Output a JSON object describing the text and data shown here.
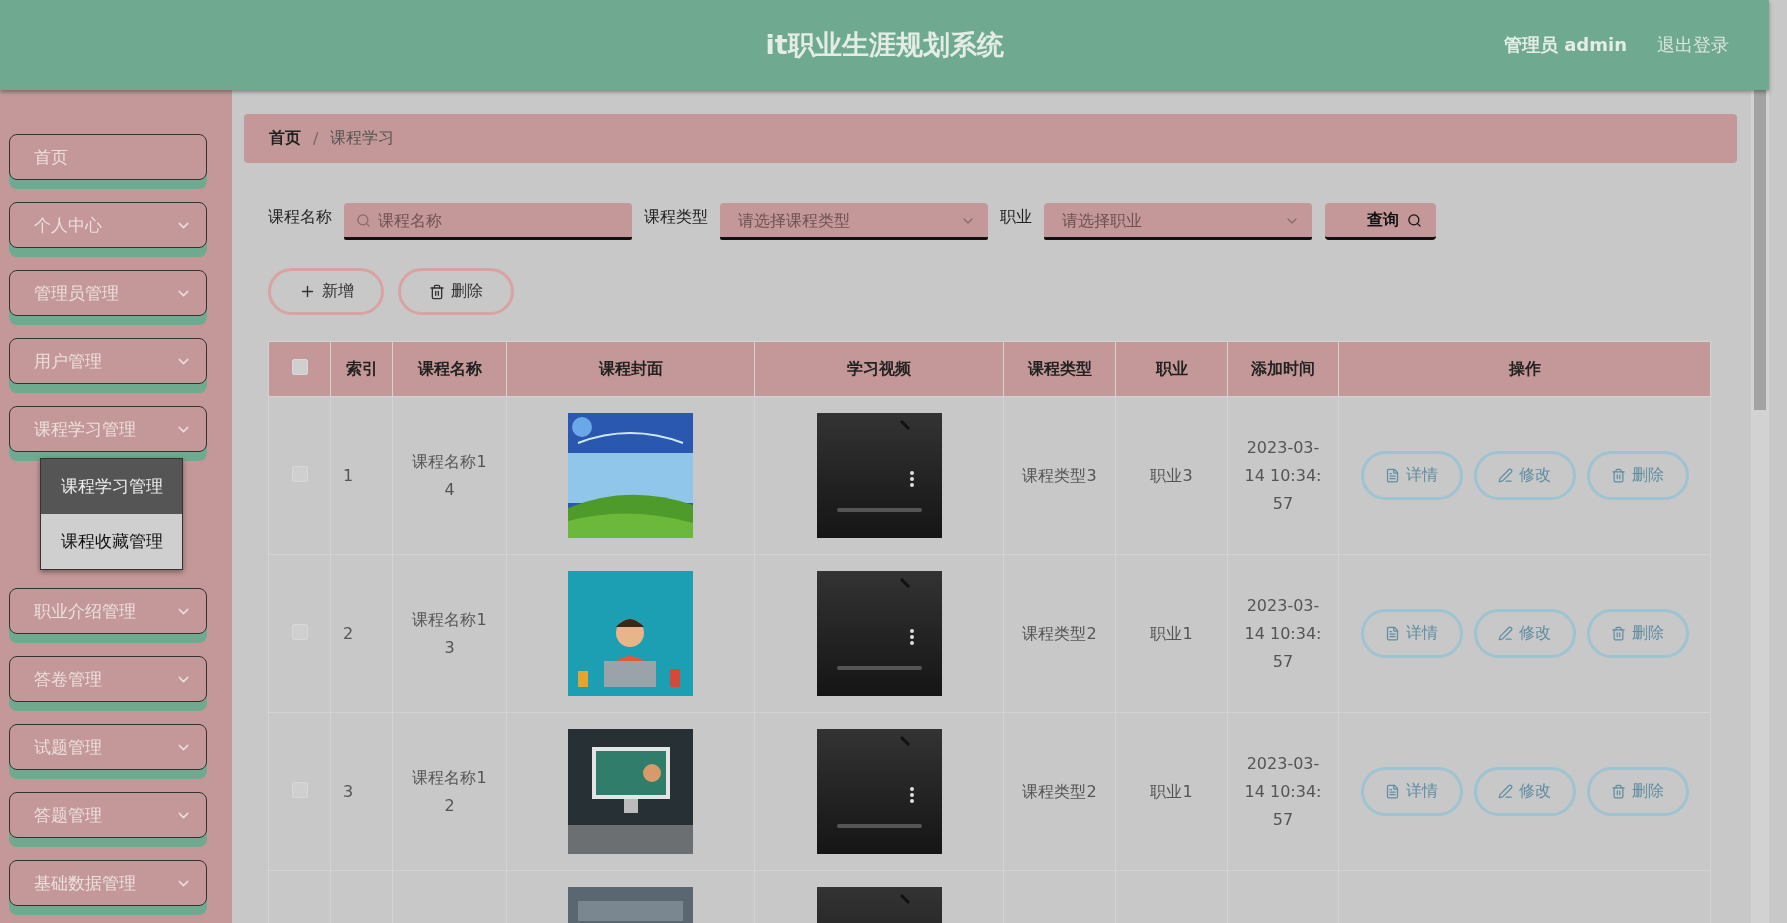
{
  "header": {
    "title": "it职业生涯规划系统",
    "user": "管理员 admin",
    "logout": "退出登录"
  },
  "sidebar": {
    "items": [
      {
        "label": "首页",
        "kind": "link"
      },
      {
        "label": "个人中心",
        "kind": "menu"
      },
      {
        "label": "管理员管理",
        "kind": "menu"
      },
      {
        "label": "用户管理",
        "kind": "menu"
      },
      {
        "label": "课程学习管理",
        "kind": "menu",
        "children": [
          {
            "label": "课程学习管理",
            "selected": true
          },
          {
            "label": "课程收藏管理",
            "selected": false
          }
        ]
      },
      {
        "label": "职业介绍管理",
        "kind": "menu"
      },
      {
        "label": "答卷管理",
        "kind": "menu"
      },
      {
        "label": "试题管理",
        "kind": "menu"
      },
      {
        "label": "答题管理",
        "kind": "menu"
      },
      {
        "label": "基础数据管理",
        "kind": "menu"
      }
    ]
  },
  "breadcrumb": {
    "separator": "/",
    "items": [
      {
        "label": "首页",
        "current": false
      },
      {
        "label": "课程学习",
        "current": true
      }
    ]
  },
  "search": {
    "fields": [
      {
        "label": "课程名称",
        "kind": "text",
        "placeholder": "课程名称"
      },
      {
        "label": "课程类型",
        "kind": "select",
        "placeholder": "请选择课程类型"
      },
      {
        "label": "职业",
        "kind": "select",
        "placeholder": "请选择职业"
      }
    ],
    "button": "查询"
  },
  "toolbar": [
    {
      "label": "新增",
      "kind": "add"
    },
    {
      "label": "删除",
      "kind": "delete"
    }
  ],
  "table": {
    "columns": [
      "索引",
      "课程名称",
      "课程封面",
      "学习视频",
      "课程类型",
      "职业",
      "添加时间",
      "操作"
    ],
    "all_checked": false,
    "rows": [
      {
        "checked": false,
        "index": "1",
        "name": "课程名称14",
        "cover": {
          "kind": "picture"
        },
        "video": {
          "kind": "picture"
        },
        "type": "课程类型3",
        "career": "职业3",
        "time": "2023-03-14 10:34:57",
        "actions": [
          {
            "label": "详情",
            "kind": "detail"
          },
          {
            "label": "修改",
            "kind": "edit"
          },
          {
            "label": "删除",
            "kind": "delete"
          }
        ]
      },
      {
        "checked": false,
        "index": "2",
        "name": "课程名称13",
        "cover": {
          "kind": "picture"
        },
        "video": {
          "kind": "picture"
        },
        "type": "课程类型2",
        "career": "职业1",
        "time": "2023-03-14 10:34:57",
        "actions": [
          {
            "label": "详情",
            "kind": "detail"
          },
          {
            "label": "修改",
            "kind": "edit"
          },
          {
            "label": "删除",
            "kind": "delete"
          }
        ]
      },
      {
        "checked": false,
        "index": "3",
        "name": "课程名称12",
        "cover": {
          "kind": "picture"
        },
        "video": {
          "kind": "picture"
        },
        "type": "课程类型2",
        "career": "职业1",
        "time": "2023-03-14 10:34:57",
        "actions": [
          {
            "label": "详情",
            "kind": "detail"
          },
          {
            "label": "修改",
            "kind": "edit"
          },
          {
            "label": "删除",
            "kind": "delete"
          }
        ]
      },
      {
        "cover": {
          "kind": "picture"
        },
        "video": {
          "kind": "picture"
        }
      }
    ]
  }
}
